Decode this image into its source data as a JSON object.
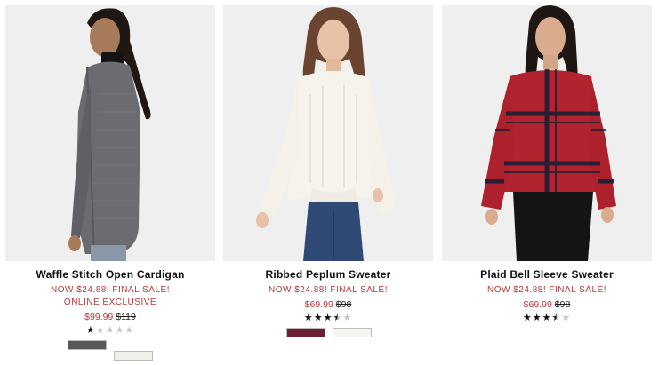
{
  "products": [
    {
      "name": "Waffle Stitch Open Cardigan",
      "promo": "NOW $24.88! FINAL SALE!",
      "exclusive": "ONLINE EXCLUSIVE",
      "sale_price": "$99.99",
      "original_price": "$119",
      "rating": 1,
      "rating_max": 5,
      "swatches": [
        {
          "color": "#555759",
          "name": "charcoal"
        },
        {
          "color": "#f2f0ea",
          "name": "ivory"
        }
      ]
    },
    {
      "name": "Ribbed Peplum Sweater",
      "promo": "NOW $24.88! FINAL SALE!",
      "exclusive": "",
      "sale_price": "$69.99",
      "original_price": "$98",
      "rating": 3.5,
      "rating_max": 5,
      "swatches": [
        {
          "color": "#6b2132",
          "name": "burgundy"
        },
        {
          "color": "#f7f5f1",
          "name": "winter white"
        }
      ]
    },
    {
      "name": "Plaid Bell Sleeve Sweater",
      "promo": "NOW $24.88! FINAL SALE!",
      "exclusive": "",
      "sale_price": "$69.99",
      "original_price": "$98",
      "rating": 3.5,
      "rating_max": 5,
      "swatches": []
    }
  ],
  "colors": {
    "sale_red": "#b5373a",
    "photo_bg": "#efefef"
  }
}
